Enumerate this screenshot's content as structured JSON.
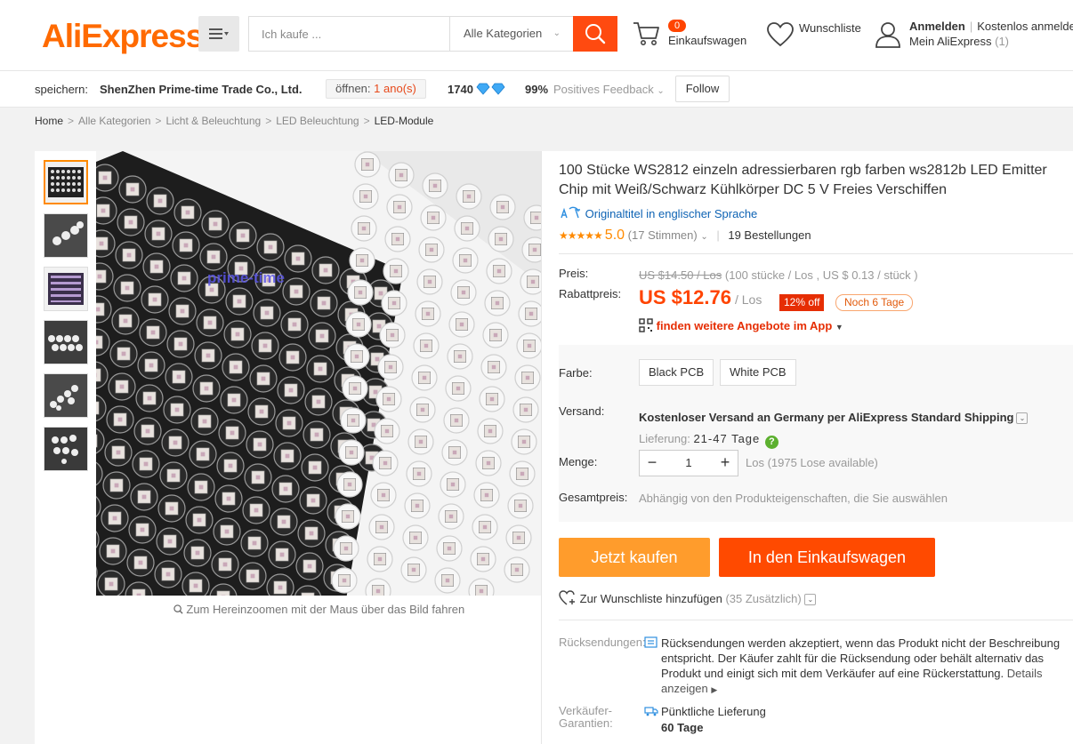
{
  "header": {
    "logo": "AliExpress",
    "logo_tm": "™",
    "search_placeholder": "Ich kaufe ...",
    "category": "Alle Kategorien",
    "cart_count": "0",
    "cart_label": "Einkaufswagen",
    "wishlist_label": "Wunschliste",
    "signin": "Anmelden",
    "register": "Kostenlos anmelden",
    "my_account": "Mein AliExpress",
    "my_account_count": "(1)"
  },
  "store": {
    "label": "speichern:",
    "name": "ShenZhen Prime-time Trade Co., Ltd.",
    "open_label": "öffnen:",
    "open_value": "1 ano(s)",
    "score": "1740",
    "feedback_pct": "99%",
    "feedback_label": "Positives Feedback",
    "follow": "Follow"
  },
  "breadcrumb": [
    "Home",
    "Alle Kategorien",
    "Licht & Beleuchtung",
    "LED Beleuchtung",
    "LED-Module"
  ],
  "gallery": {
    "zoom_hint": "Zum Hereinzoomen mit der Maus über das Bild fahren",
    "watermark": "prime-time"
  },
  "product": {
    "title": "100 Stücke WS2812 einzeln adressierbaren rgb farben ws2812b LED Emitter Chip mit Weiß/Schwarz Kühlkörper DC 5 V Freies Verschiffen",
    "original_title_link": "Originaltitel in englischer Sprache",
    "rating_score": "5.0",
    "votes": "(17 Stimmen)",
    "orders": "19 Bestellungen"
  },
  "price": {
    "price_label": "Preis:",
    "old_price": "US $14.50 / Los",
    "old_detail": "(100 stücke / Los , US $ 0.13 / stück )",
    "discount_label": "Rabattpreis:",
    "current": "US $12.76",
    "unit": "/ Los",
    "off": "12% off",
    "remaining": "Noch 6 Tage",
    "app_promo": "finden weitere Angebote im App"
  },
  "options": {
    "color_label": "Farbe:",
    "colors": [
      "Black PCB",
      "White PCB"
    ],
    "shipping_label": "Versand:",
    "shipping_prefix": "Kostenloser Versand an",
    "shipping_country": "Germany per AliExpress Standard Shipping",
    "delivery_label": "Lieferung:",
    "delivery_value": "21-47 Tage",
    "qty_label": "Menge:",
    "qty_value": "1",
    "qty_info": "Los (1975 Lose available)",
    "total_label": "Gesamtpreis:",
    "total_info": "Abhängig von den Produkteigenschaften, die Sie auswählen"
  },
  "actions": {
    "buy_now": "Jetzt kaufen",
    "add_to_cart": "In den Einkaufswagen",
    "add_wishlist": "Zur Wunschliste hinzufügen",
    "wishlist_count": "(35 Zusätzlich)"
  },
  "policy": {
    "returns_label": "Rücksendungen:",
    "returns_text": "Rücksendungen werden akzeptiert, wenn das Produkt nicht der Beschreibung entspricht. Der Käufer zahlt für die Rücksendung oder behält alternativ das Produkt und einigt sich mit dem Verkäufer auf eine Rückerstattung.",
    "details_link": "Details anzeigen",
    "guarantee_label": "Verkäufer-Garantien:",
    "guarantee_title": "Pünktliche Lieferung",
    "guarantee_days": "60 Tage"
  },
  "colors": {
    "brand": "#ff6a00",
    "price": "#ff4400",
    "buy_button": "#ff9c2c",
    "cart_button": "#ff4a00",
    "link": "#0e63b4"
  }
}
